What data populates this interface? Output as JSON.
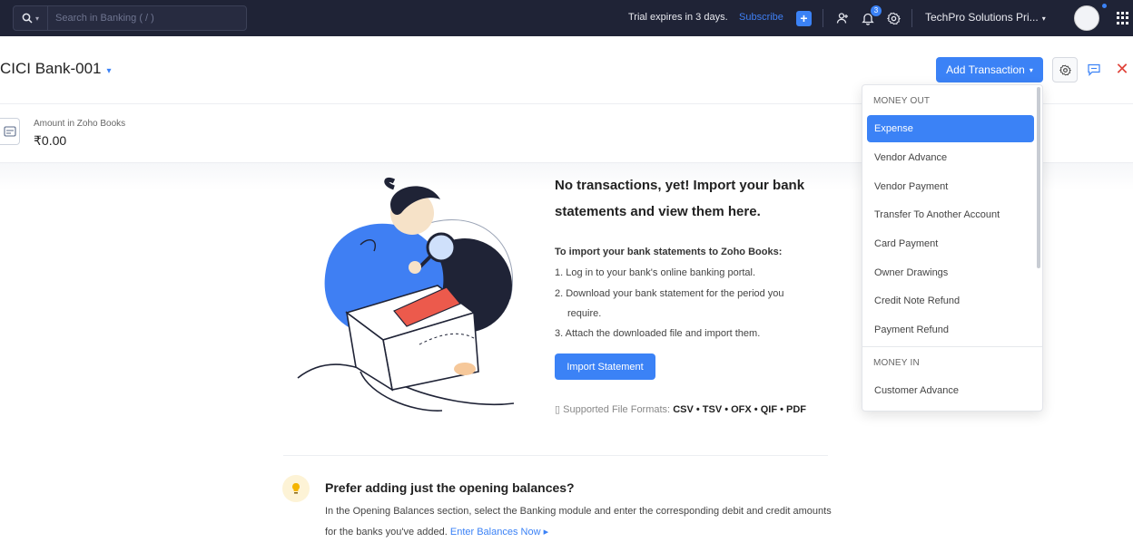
{
  "topbar": {
    "search_placeholder": "Search in Banking ( / )",
    "trial_text": "Trial expires in 3 days.",
    "subscribe_label": "Subscribe",
    "notification_count": "3",
    "org_name": "TechPro Solutions Pri..."
  },
  "header": {
    "account_name": "CICI Bank-001",
    "add_transaction_label": "Add Transaction"
  },
  "summary": {
    "amount_label": "Amount in Zoho Books",
    "amount_value": "₹0.00"
  },
  "empty_state": {
    "title": "No transactions, yet! Import your bank statements and view them here.",
    "steps_heading": "To import your bank statements to Zoho Books:",
    "steps": [
      "1. Log in to your bank's online banking portal.",
      "2. Download your bank statement for the period you",
      "require.",
      "3. Attach the downloaded file and import them."
    ],
    "import_button": "Import Statement",
    "formats_label": "Supported File Formats:",
    "formats_value": "CSV • TSV • OFX • QIF • PDF"
  },
  "opening_balances": {
    "title": "Prefer adding just the opening balances?",
    "text": "In the Opening Balances section, select the Banking module and enter the corresponding debit and credit amounts for the banks you've added.",
    "link": "Enter Balances Now ▸"
  },
  "dropdown": {
    "money_out_label": "MONEY OUT",
    "money_out_items": [
      "Expense",
      "Vendor Advance",
      "Vendor Payment",
      "Transfer To Another Account",
      "Card Payment",
      "Owner Drawings",
      "Credit Note Refund",
      "Payment Refund"
    ],
    "money_in_label": "MONEY IN",
    "money_in_items": [
      "Customer Advance"
    ],
    "selected_item": "Expense"
  },
  "colors": {
    "topbar_bg": "#1f2336",
    "accent": "#3b82f6",
    "close": "#e0443a"
  }
}
